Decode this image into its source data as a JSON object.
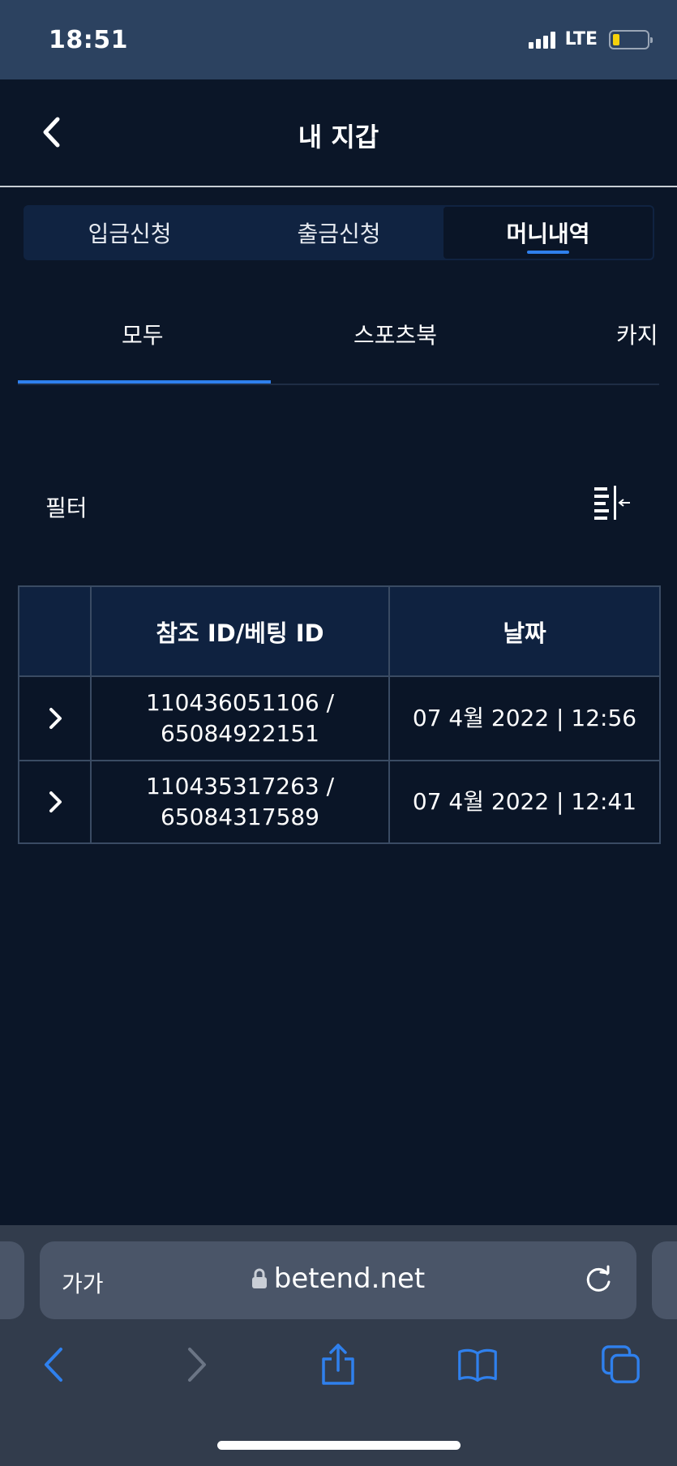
{
  "status": {
    "time": "18:51",
    "network": "LTE"
  },
  "header": {
    "title": "내 지갑",
    "back_icon": "chevron-left-icon"
  },
  "segments": [
    {
      "label": "입금신청",
      "active": false
    },
    {
      "label": "출금신청",
      "active": false
    },
    {
      "label": "머니내역",
      "active": true
    }
  ],
  "subtabs": [
    {
      "label": "모두",
      "active": true
    },
    {
      "label": "스포츠북",
      "active": false
    },
    {
      "label": "카지",
      "active": false
    }
  ],
  "filter": {
    "label": "필터",
    "icon": "filter-collapse-icon"
  },
  "table": {
    "headers": [
      "",
      "참조 ID/베팅 ID",
      "날짜"
    ],
    "rows": [
      {
        "ref_line1": "110436051106 /",
        "ref_line2": "65084922151",
        "date": "07 4월 2022 | 12:56"
      },
      {
        "ref_line1": "110435317263 /",
        "ref_line2": "65084317589",
        "date": "07 4월 2022 | 12:41"
      }
    ]
  },
  "browser": {
    "text_size_label": "가가",
    "url": "betend.net"
  },
  "colors": {
    "background": "#0b1628",
    "accent": "#2f80ed",
    "status_bar": "#2c4260",
    "safari_bar": "#323c4c",
    "toolbar_icon": "#2f80ed"
  }
}
